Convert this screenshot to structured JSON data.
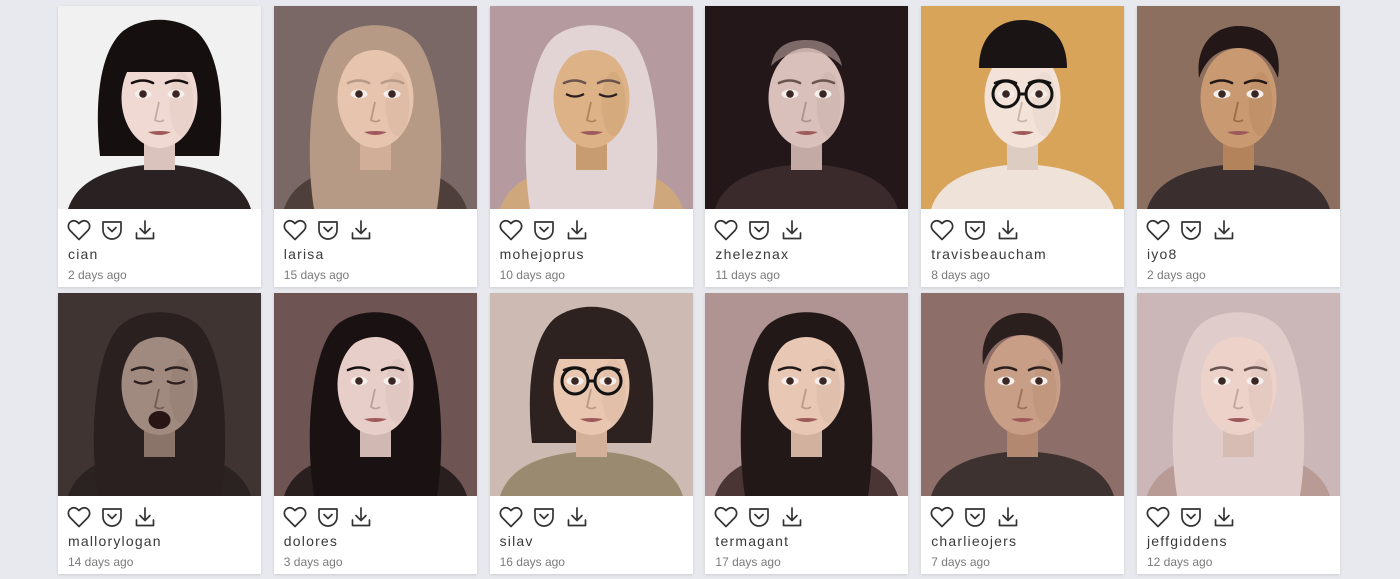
{
  "gallery": {
    "cards": [
      {
        "username": "cian",
        "time": "2 days ago",
        "bg": "#f2f1f1",
        "hair": "#15100f",
        "skin": "#efd9d2",
        "shirt": "#2a2222",
        "hairStyle": "bob",
        "glasses": false,
        "eyesClosed": false,
        "mouthOpen": false
      },
      {
        "username": "larisa",
        "time": "15 days ago",
        "bg": "#7a6866",
        "hair": "#b79a86",
        "skin": "#e6c4ae",
        "shirt": "#4e3f3a",
        "hairStyle": "long",
        "glasses": false,
        "eyesClosed": false,
        "mouthOpen": false
      },
      {
        "username": "mohejoprus",
        "time": "10 days ago",
        "bg": "#b59aa0",
        "hair": "#e2d3d4",
        "skin": "#ddb286",
        "shirt": "#cfa77d",
        "hairStyle": "long",
        "glasses": false,
        "eyesClosed": true,
        "mouthOpen": false
      },
      {
        "username": "zheleznax",
        "time": "11 days ago",
        "bg": "#241719",
        "hair": "#cfb8b4",
        "skin": "#d9c0ba",
        "shirt": "#3b2a2c",
        "hairStyle": "bald",
        "glasses": false,
        "eyesClosed": false,
        "mouthOpen": false
      },
      {
        "username": "travisbeaucham",
        "time": "8 days ago",
        "bg": "#d8a45a",
        "hair": "#1a1414",
        "skin": "#f3e2d8",
        "shirt": "#efe2d8",
        "hairStyle": "cap",
        "glasses": true,
        "eyesClosed": false,
        "mouthOpen": false
      },
      {
        "username": "iyo8",
        "time": "2 days ago",
        "bg": "#8c6f5e",
        "hair": "#231717",
        "skin": "#c99a72",
        "shirt": "#3a2e2e",
        "hairStyle": "short",
        "glasses": false,
        "eyesClosed": false,
        "mouthOpen": false
      },
      {
        "username": "mallorylogan",
        "time": "14 days ago",
        "bg": "#403432",
        "hair": "#2a201f",
        "skin": "#a08a80",
        "shirt": "#2b2322",
        "hairStyle": "long",
        "glasses": false,
        "eyesClosed": true,
        "mouthOpen": true
      },
      {
        "username": "dolores",
        "time": "3 days ago",
        "bg": "#6e5452",
        "hair": "#1a1212",
        "skin": "#e8cec8",
        "shirt": "#2a1f1f",
        "hairStyle": "long",
        "glasses": false,
        "eyesClosed": false,
        "mouthOpen": false
      },
      {
        "username": "silav",
        "time": "16 days ago",
        "bg": "#cdbab2",
        "hair": "#2e2220",
        "skin": "#e9c6b0",
        "shirt": "#9a8a70",
        "hairStyle": "bob",
        "glasses": true,
        "eyesClosed": false,
        "mouthOpen": false
      },
      {
        "username": "termagant",
        "time": "17 days ago",
        "bg": "#b09494",
        "hair": "#221818",
        "skin": "#e8c7b4",
        "shirt": "#4a3434",
        "hairStyle": "long",
        "glasses": false,
        "eyesClosed": false,
        "mouthOpen": false
      },
      {
        "username": "charlieojers",
        "time": "7 days ago",
        "bg": "#8e6e68",
        "hair": "#2a1f1d",
        "skin": "#c89e86",
        "shirt": "#3e3230",
        "hairStyle": "short",
        "glasses": false,
        "eyesClosed": false,
        "mouthOpen": false
      },
      {
        "username": "jeffgiddens",
        "time": "12 days ago",
        "bg": "#cbb7b8",
        "hair": "#e0cccb",
        "skin": "#ecd2c8",
        "shirt": "#b89b94",
        "hairStyle": "long",
        "glasses": false,
        "eyesClosed": false,
        "mouthOpen": false
      }
    ]
  },
  "icons": {
    "like": "heart-icon",
    "save": "pocket-icon",
    "download": "download-icon"
  },
  "colors": {
    "page_bg": "#e8e9ee",
    "card_bg": "#ffffff",
    "icon_stroke": "#333333"
  }
}
